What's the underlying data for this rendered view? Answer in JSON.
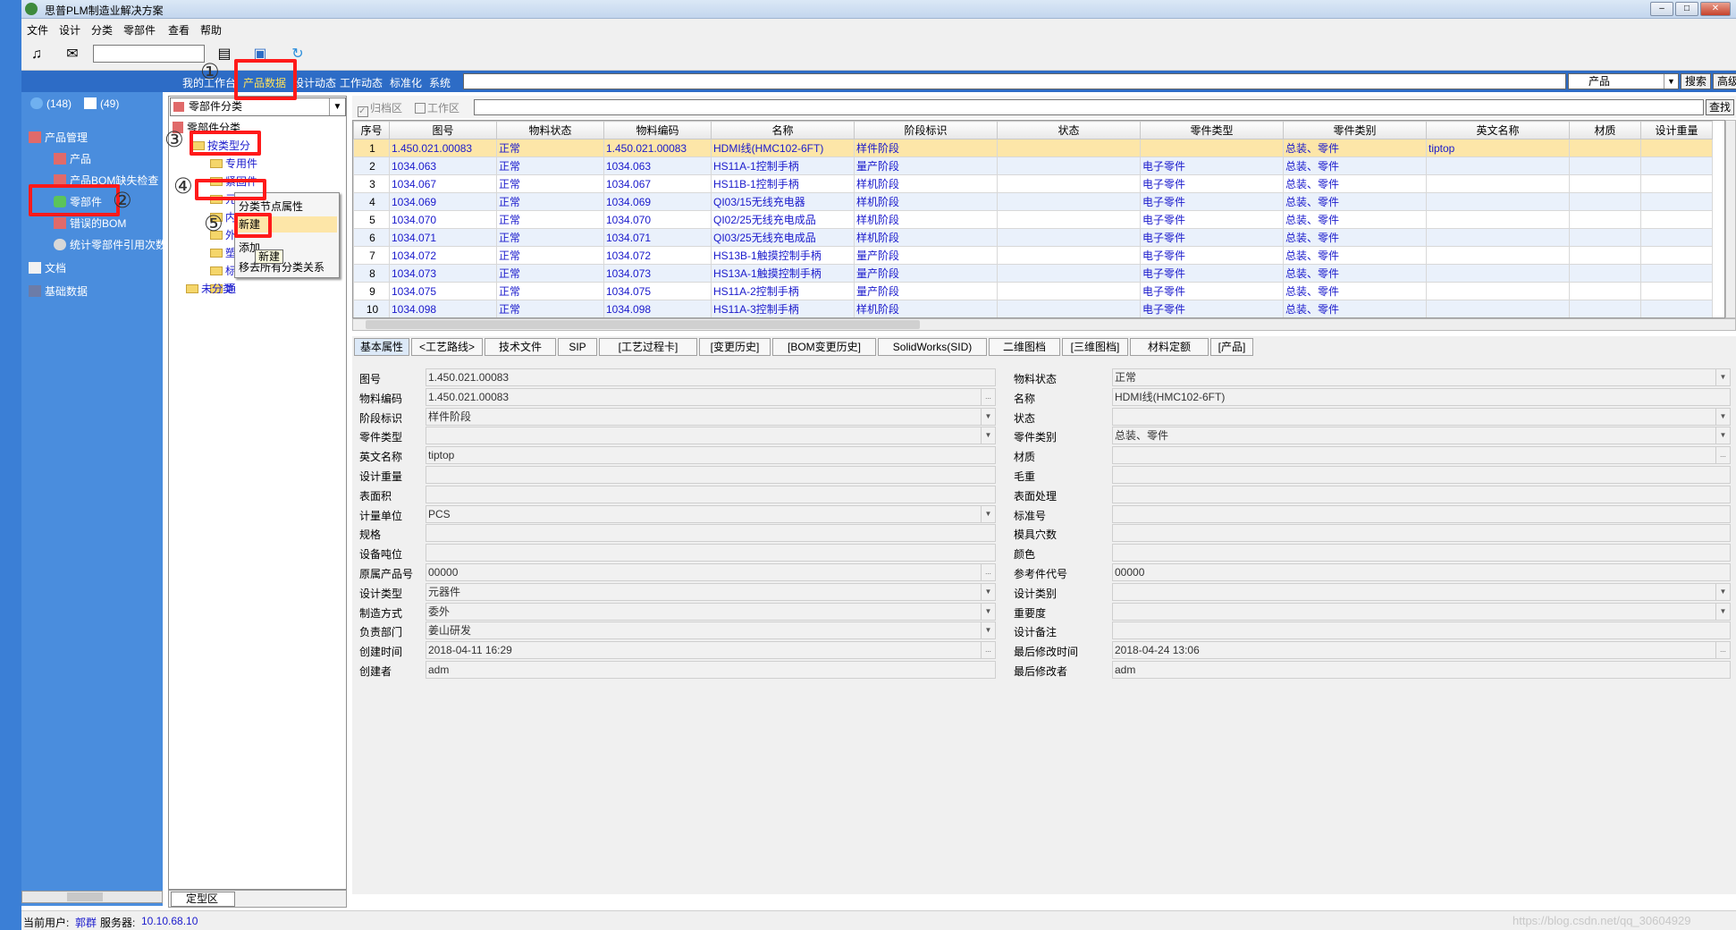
{
  "window": {
    "title": "思普PLM制造业解决方案",
    "btn_min": "–",
    "btn_max": "□",
    "btn_close": "✕"
  },
  "menu": [
    "文件",
    "设计",
    "分类",
    "零部件",
    "查看",
    "帮助"
  ],
  "nav": {
    "tabs": [
      "我的工作台",
      "产品数据",
      "设计动态",
      "工作动态",
      "标准化",
      "系统"
    ],
    "search_select": "产品",
    "search_btn": "搜索",
    "advanced_btn": "高级"
  },
  "sidebar": {
    "task_count": "(148)",
    "mail_count": "(49)",
    "items": [
      "产品管理",
      "产品",
      "产品BOM缺失检查",
      "零部件",
      "错误的BOM",
      "统计零部件引用次数",
      "文档",
      "基础数据"
    ]
  },
  "tree": {
    "combo": "零部件分类",
    "nodes": [
      "零部件分类",
      "按类型分",
      "专用件",
      "紧固件",
      "元器件",
      "内",
      "外",
      "塑",
      "标",
      "通",
      "未分类"
    ],
    "bottom_tab": "定型区"
  },
  "context_menu": {
    "items": [
      "分类节点属性",
      "新建",
      "添加",
      "移去所有分类关系"
    ],
    "tooltip": "新建"
  },
  "grid_top": {
    "archive": "归档区",
    "work": "工作区",
    "find_btn": "查找"
  },
  "grid": {
    "headers": [
      "序号",
      "图号",
      "物料状态",
      "物料编码",
      "名称",
      "阶段标识",
      "状态",
      "零件类型",
      "零件类别",
      "英文名称",
      "材质",
      "设计重量"
    ],
    "rows": [
      [
        "1",
        "1.450.021.00083",
        "正常",
        "1.450.021.00083",
        "HDMI线(HMC102-6FT)",
        "样件阶段",
        "",
        "",
        "总装、零件",
        "tiptop",
        "",
        ""
      ],
      [
        "2",
        "1034.063",
        "正常",
        "1034.063",
        "HS11A-1控制手柄",
        "量产阶段",
        "",
        "电子零件",
        "总装、零件",
        "",
        "",
        ""
      ],
      [
        "3",
        "1034.067",
        "正常",
        "1034.067",
        "HS11B-1控制手柄",
        "样机阶段",
        "",
        "电子零件",
        "总装、零件",
        "",
        "",
        ""
      ],
      [
        "4",
        "1034.069",
        "正常",
        "1034.069",
        "QI03/15无线充电器",
        "样机阶段",
        "",
        "电子零件",
        "总装、零件",
        "",
        "",
        ""
      ],
      [
        "5",
        "1034.070",
        "正常",
        "1034.070",
        "QI02/25无线充电成品",
        "样机阶段",
        "",
        "电子零件",
        "总装、零件",
        "",
        "",
        ""
      ],
      [
        "6",
        "1034.071",
        "正常",
        "1034.071",
        "QI03/25无线充电成品",
        "样机阶段",
        "",
        "电子零件",
        "总装、零件",
        "",
        "",
        ""
      ],
      [
        "7",
        "1034.072",
        "正常",
        "1034.072",
        "HS13B-1触摸控制手柄",
        "量产阶段",
        "",
        "电子零件",
        "总装、零件",
        "",
        "",
        ""
      ],
      [
        "8",
        "1034.073",
        "正常",
        "1034.073",
        "HS13A-1触摸控制手柄",
        "量产阶段",
        "",
        "电子零件",
        "总装、零件",
        "",
        "",
        ""
      ],
      [
        "9",
        "1034.075",
        "正常",
        "1034.075",
        "HS11A-2控制手柄",
        "量产阶段",
        "",
        "电子零件",
        "总装、零件",
        "",
        "",
        ""
      ],
      [
        "10",
        "1034.098",
        "正常",
        "1034.098",
        "HS11A-3控制手柄",
        "样机阶段",
        "",
        "电子零件",
        "总装、零件",
        "",
        "",
        ""
      ]
    ]
  },
  "tabs": [
    "基本属性",
    "<工艺路线>",
    "技术文件",
    "SIP",
    "[工艺过程卡]",
    "[变更历史]",
    "[BOM变更历史]",
    "SolidWorks(SID)",
    "二维图档",
    "[三维图档]",
    "材料定额",
    "[产品]"
  ],
  "props": {
    "left": [
      {
        "label": "图号",
        "value": "1.450.021.00083"
      },
      {
        "label": "物料编码",
        "value": "1.450.021.00083"
      },
      {
        "label": "阶段标识",
        "value": "样件阶段"
      },
      {
        "label": "零件类型",
        "value": ""
      },
      {
        "label": "英文名称",
        "value": "tiptop"
      },
      {
        "label": "设计重量",
        "value": ""
      },
      {
        "label": "表面积",
        "value": ""
      },
      {
        "label": "计量单位",
        "value": "PCS"
      },
      {
        "label": "规格",
        "value": ""
      },
      {
        "label": "设备吨位",
        "value": ""
      },
      {
        "label": "原属产品号",
        "value": "00000"
      },
      {
        "label": "设计类型",
        "value": "元器件"
      },
      {
        "label": "制造方式",
        "value": "委外"
      },
      {
        "label": "负责部门",
        "value": "姜山研发"
      },
      {
        "label": "创建时间",
        "value": "2018-04-11 16:29"
      },
      {
        "label": "创建者",
        "value": "adm"
      }
    ],
    "right": [
      {
        "label": "物料状态",
        "value": "正常"
      },
      {
        "label": "名称",
        "value": "HDMI线(HMC102-6FT)"
      },
      {
        "label": "状态",
        "value": ""
      },
      {
        "label": "零件类别",
        "value": "总装、零件"
      },
      {
        "label": "材质",
        "value": ""
      },
      {
        "label": "毛重",
        "value": ""
      },
      {
        "label": "表面处理",
        "value": ""
      },
      {
        "label": "标准号",
        "value": ""
      },
      {
        "label": "模具穴数",
        "value": ""
      },
      {
        "label": "颜色",
        "value": ""
      },
      {
        "label": "参考件代号",
        "value": "00000"
      },
      {
        "label": "设计类别",
        "value": ""
      },
      {
        "label": "重要度",
        "value": ""
      },
      {
        "label": "设计备注",
        "value": ""
      },
      {
        "label": "最后修改时间",
        "value": "2018-04-24 13:06"
      },
      {
        "label": "最后修改者",
        "value": "adm"
      }
    ]
  },
  "status": {
    "user_label": "当前用户:",
    "user": "郭群",
    "server_label": "服务器:",
    "server": "10.10.68.10",
    "watermark": "https://blog.csdn.net/qq_30604929"
  },
  "callouts": [
    "①",
    "②",
    "③",
    "④",
    "⑤"
  ]
}
